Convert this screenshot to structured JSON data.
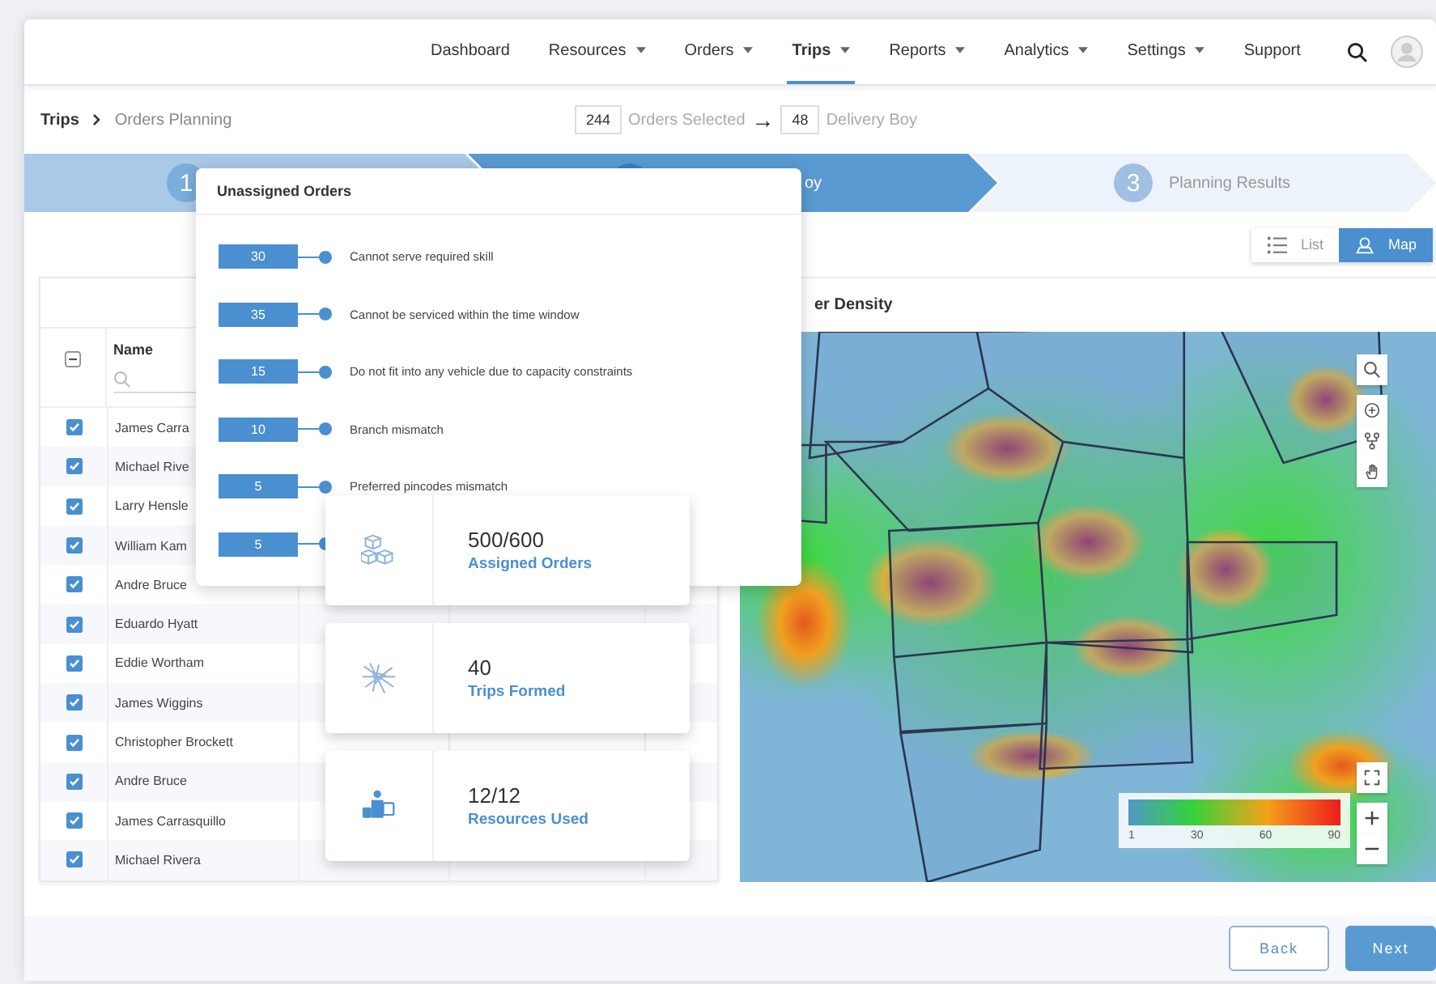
{
  "nav": {
    "items": [
      {
        "label": "Dashboard",
        "selected": false,
        "dropdown": false
      },
      {
        "label": "Resources",
        "selected": false,
        "dropdown": true
      },
      {
        "label": "Orders",
        "selected": false,
        "dropdown": true
      },
      {
        "label": "Trips",
        "selected": true,
        "dropdown": true
      },
      {
        "label": "Reports",
        "selected": false,
        "dropdown": true
      },
      {
        "label": "Analytics",
        "selected": false,
        "dropdown": true
      },
      {
        "label": "Settings",
        "selected": false,
        "dropdown": true
      },
      {
        "label": "Support",
        "selected": false,
        "dropdown": false
      }
    ]
  },
  "breadcrumb": [
    "Trips",
    "Orders Planning"
  ],
  "selection": {
    "orders_count": "244",
    "orders_label": "Orders Selected",
    "arrow": "→",
    "resources_count": "48",
    "resources_label": "Delivery Boy"
  },
  "stepper": [
    {
      "number": "1",
      "done": true,
      "selected": false
    },
    {
      "label": "oy",
      "done": false,
      "selected": true
    },
    {
      "number": "3",
      "label": "Planning Results",
      "done": false,
      "selected": false
    }
  ],
  "view_toggle": [
    {
      "label": "List",
      "selected": false
    },
    {
      "label": "Map",
      "selected": true
    }
  ],
  "table": {
    "select_all": {
      "indeterminate": true
    },
    "columns": [
      "Name"
    ],
    "rows": [
      {
        "name": "James Carra",
        "checked": true
      },
      {
        "name": "Michael Rive",
        "checked": true
      },
      {
        "name": "Larry Hensle",
        "checked": true
      },
      {
        "name": "William Kam",
        "checked": true
      },
      {
        "name": "Andre Bruce",
        "checked": true
      },
      {
        "name": "Eduardo Hyatt",
        "checked": true
      },
      {
        "name": "Eddie Wortham",
        "checked": true
      },
      {
        "name": "James Wiggins",
        "checked": true
      },
      {
        "name": "Christopher Brockett",
        "checked": true
      },
      {
        "name": "Andre Bruce",
        "checked": true
      },
      {
        "name": "James Carrasquillo",
        "checked": true
      },
      {
        "name": "Michael Rivera",
        "checked": true
      }
    ]
  },
  "map": {
    "title": "er Density",
    "legend": {
      "ticks": [
        "1",
        "30",
        "60",
        "90"
      ]
    }
  },
  "unassigned": {
    "title": "Unassigned Orders",
    "reasons": [
      {
        "count": "30",
        "label": "Cannot serve required skill"
      },
      {
        "count": "35",
        "label": "Cannot be serviced within the time window"
      },
      {
        "count": "15",
        "label": "Do not fit into any vehicle due to capacity constraints"
      },
      {
        "count": "10",
        "label": "Branch mismatch"
      },
      {
        "count": "5",
        "label": "Preferred pincodes mismatch"
      },
      {
        "count": "5"
      }
    ]
  },
  "stats": [
    {
      "kind": "orders",
      "value": "500/600",
      "label": "Assigned Orders"
    },
    {
      "kind": "trips",
      "value": "40",
      "label": "Trips Formed"
    },
    {
      "kind": "resources",
      "value": "12/12",
      "label": "Resources Used"
    }
  ],
  "footer": {
    "buttons": [
      {
        "label": "Back",
        "kind": "secondary"
      },
      {
        "label": "Next",
        "kind": "primary"
      }
    ]
  }
}
